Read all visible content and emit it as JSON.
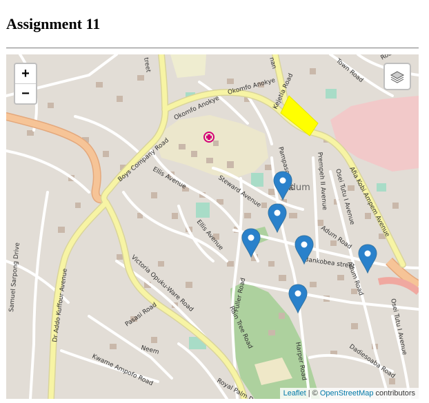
{
  "page": {
    "title": "Assignment 11"
  },
  "map": {
    "controls": {
      "zoom_in": "+",
      "zoom_out": "−"
    },
    "attribution": {
      "leaflet": "Leaflet",
      "separator": " | © ",
      "osm": "OpenStreetMap",
      "suffix": " contributors"
    },
    "labels": {
      "okomfo1": "Okomfo Anokye",
      "okomfo2": "Okomfo Anokye",
      "kejetia": "Kejetia Road",
      "boys": "Boys Company Road",
      "ellis": "Ellis Avenue",
      "ellis2": "Ellis Avenue",
      "steward": "Steward Avenue",
      "victoria": "Victoria Opuku-Ware Road",
      "addo": "Dr Addo Kuffour Avenue",
      "samuel": "Samuel Sarpong Drive",
      "fuller": "Fuller Road",
      "raintree": "Rain Tree Road",
      "harper": "Harper Road",
      "prempeh": "Prempeh II Avenue",
      "osei1": "Osei Tutu I Avenue",
      "osei2": "Osei Tutu I Avenue",
      "afia": "Afia Kobi Ampem Avenue",
      "adum": "Adum",
      "adumroad": "Adum Road",
      "adumroad2": "Adum Road",
      "bankobea": "Bankobea street",
      "pampaso": "Pampaso Lane",
      "passasi": "Pasasi Road",
      "neem": "Neem",
      "kwame": "Kwame Ampofo Road",
      "royal": "Royal Palm Drive",
      "dadiesoaba": "Dadiesoaba Road",
      "town": "Town Road",
      "nan": "nan",
      "treet": "treet",
      "kearoad": "Road"
    },
    "markers": [
      {
        "name": "marker-1"
      },
      {
        "name": "marker-2"
      },
      {
        "name": "marker-3"
      },
      {
        "name": "marker-4"
      },
      {
        "name": "marker-5"
      },
      {
        "name": "marker-6"
      }
    ],
    "colors": {
      "marker": "#2a81cb",
      "highlight": "#ffff00",
      "major_road": "#f7f4a4",
      "trunk": "#f6c497",
      "park": "#add19e"
    }
  }
}
